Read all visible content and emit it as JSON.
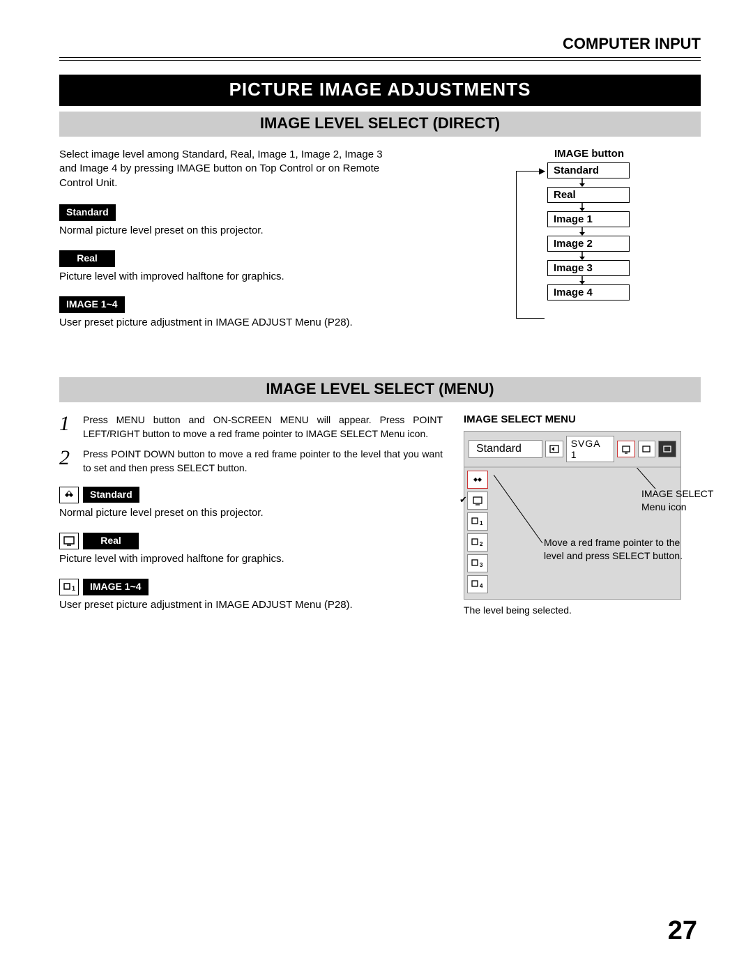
{
  "header": {
    "section": "COMPUTER INPUT"
  },
  "title": "PICTURE IMAGE ADJUSTMENTS",
  "direct": {
    "heading": "IMAGE LEVEL SELECT (DIRECT)",
    "intro": "Select image level among Standard, Real, Image 1, Image 2, Image 3 and Image 4 by pressing IMAGE button on Top Control or on Remote Control Unit.",
    "items": [
      {
        "chip": "Standard",
        "desc": "Normal picture level preset on this projector."
      },
      {
        "chip": "Real",
        "desc": "Picture level with improved halftone for graphics."
      },
      {
        "chip": "IMAGE 1~4",
        "desc": "User preset picture adjustment in IMAGE ADJUST Menu (P28)."
      }
    ],
    "flow": {
      "title": "IMAGE button",
      "boxes": [
        "Standard",
        "Real",
        "Image 1",
        "Image 2",
        "Image 3",
        "Image 4"
      ]
    }
  },
  "menu": {
    "heading": "IMAGE LEVEL SELECT (MENU)",
    "steps": [
      {
        "n": "1",
        "text": "Press MENU button and ON-SCREEN MENU will appear.  Press POINT LEFT/RIGHT button to move a red frame pointer to IMAGE SELECT Menu icon."
      },
      {
        "n": "2",
        "text": "Press POINT DOWN button to move a red frame pointer to the level that you want to set and then press SELECT button."
      }
    ],
    "items": [
      {
        "chip": "Standard",
        "desc": "Normal picture level preset on this projector."
      },
      {
        "chip": "Real",
        "desc": "Picture level with improved halftone for graphics."
      },
      {
        "chip": "IMAGE 1~4",
        "desc": "User preset picture adjustment in IMAGE ADJUST Menu (P28)."
      }
    ],
    "panel": {
      "title": "IMAGE SELECT MENU",
      "current": "Standard",
      "mode": "SVGA 1",
      "side_items": [
        "1",
        "2",
        "3",
        "4"
      ],
      "callout1a": "IMAGE SELECT",
      "callout1b": "Menu icon",
      "callout2": "Move a red frame pointer to the level and press SELECT button.",
      "caption": "The level being selected."
    }
  },
  "pageNumber": "27"
}
